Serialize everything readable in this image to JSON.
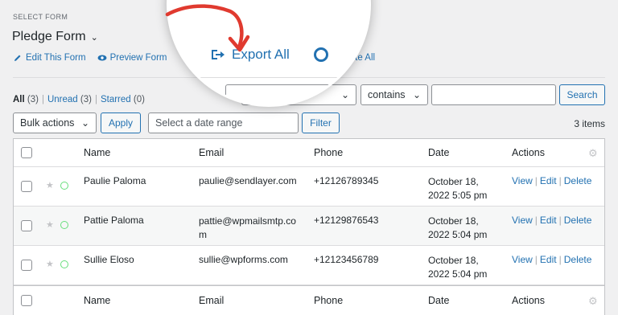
{
  "header": {
    "select_label": "SELECT FORM",
    "form_name": "Pledge Form"
  },
  "actions": {
    "edit": "Edit This Form",
    "preview": "Preview Form",
    "export": "Export All",
    "delete_all": "Delete All"
  },
  "filters": {
    "all_label": "All",
    "all_count": "(3)",
    "unread_label": "Unread",
    "unread_count": "(3)",
    "starred_label": "Starred",
    "starred_count": "(0)",
    "operator": "contains",
    "search_button": "Search",
    "bulk_actions": "Bulk actions",
    "apply_button": "Apply",
    "date_placeholder": "Select a date range",
    "filter_button": "Filter",
    "items_count": "3 items"
  },
  "table": {
    "columns": [
      "Name",
      "Email",
      "Phone",
      "Date",
      "Actions"
    ],
    "rows": [
      {
        "name": "Paulie Paloma",
        "email_l1": "paulie@sendlayer.com",
        "email_l2": "",
        "phone": "+12126789345",
        "date_l1": "October 18,",
        "date_l2": "2022 5:05 pm"
      },
      {
        "name": "Pattie Paloma",
        "email_l1": "pattie@wpmailsmtp.co",
        "email_l2": "m",
        "phone": "+12129876543",
        "date_l1": "October 18,",
        "date_l2": "2022 5:04 pm"
      },
      {
        "name": "Sullie Eloso",
        "email_l1": "sullie@wpforms.com",
        "email_l2": "",
        "phone": "+12123456789",
        "date_l1": "October 18,",
        "date_l2": "2022 5:04 pm"
      }
    ],
    "row_actions": [
      "View",
      "Edit",
      "Delete"
    ]
  },
  "colors": {
    "accent": "#2271b1",
    "annotation_red": "#e03a2f",
    "read_dot": "#68de7c"
  }
}
